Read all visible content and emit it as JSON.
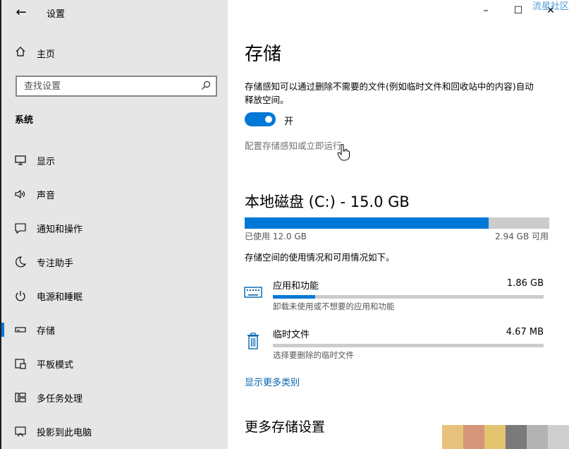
{
  "window": {
    "title": "设置",
    "watermark": "流星社区"
  },
  "sidebar": {
    "home_label": "主页",
    "search_placeholder": "查找设置",
    "section_label": "系统",
    "items": [
      {
        "label": "显示",
        "icon": "monitor-icon"
      },
      {
        "label": "声音",
        "icon": "speaker-icon"
      },
      {
        "label": "通知和操作",
        "icon": "notification-icon"
      },
      {
        "label": "专注助手",
        "icon": "moon-icon"
      },
      {
        "label": "电源和睡眠",
        "icon": "power-icon"
      },
      {
        "label": "存储",
        "icon": "drive-icon",
        "active": true
      },
      {
        "label": "平板模式",
        "icon": "tablet-icon"
      },
      {
        "label": "多任务处理",
        "icon": "multitask-icon"
      },
      {
        "label": "投影到此电脑",
        "icon": "project-icon"
      }
    ]
  },
  "main": {
    "title": "存储",
    "description": "存储感知可以通过删除不需要的文件(例如临时文件和回收站中的内容)自动释放空间。",
    "toggle_state": "开",
    "toggle_on": true,
    "config_link": "配置存储感知或立即运行",
    "disk_title": "本地磁盘 (C:) - 15.0 GB",
    "disk_used_label": "已使用 12.0 GB",
    "disk_free_label": "2.94 GB 可用",
    "disk_used_fraction": 0.8,
    "usage_desc": "存储空间的使用情况和可用情况如下。",
    "categories": [
      {
        "name": "应用和功能",
        "size": "1.86 GB",
        "sub": "卸载未使用或不想要的应用和功能",
        "fraction": 0.155,
        "icon": "keyboard-icon"
      },
      {
        "name": "临时文件",
        "size": "4.67 MB",
        "sub": "选择要删除的临时文件",
        "fraction": 0.0,
        "icon": "trash-icon"
      }
    ],
    "more_link": "显示更多类别",
    "more_settings": "更多存储设置"
  },
  "colors": {
    "accent": "#0078d7",
    "sidebar_bg": "#e6e6e6",
    "bar_bg": "#cccccc"
  },
  "swatch_colors": [
    "#e7c27d",
    "#d4967a",
    "#e3c46f",
    "#7a7a7a",
    "#b3b3b3",
    "#cfcfcf"
  ]
}
